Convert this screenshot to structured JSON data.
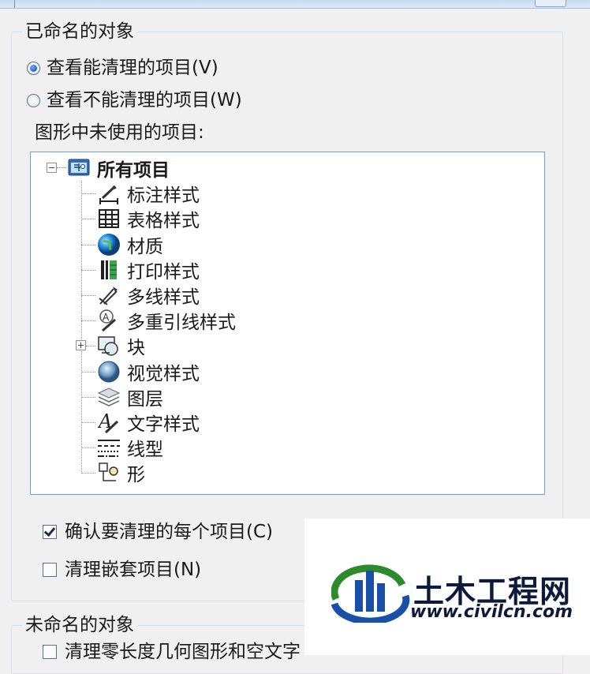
{
  "named_group": {
    "title": "已命名的对象",
    "radio_purgeable": "查看能清理的项目(V)",
    "radio_not_purgeable": "查看不能清理的项目(W)",
    "tree_caption": "图形中未使用的项目:",
    "tree": {
      "root": "所有项目",
      "items": [
        {
          "label": "标注样式",
          "icon": "dimension-style-icon"
        },
        {
          "label": "表格样式",
          "icon": "table-style-icon"
        },
        {
          "label": "材质",
          "icon": "material-globe-icon"
        },
        {
          "label": "打印样式",
          "icon": "plot-style-icon"
        },
        {
          "label": "多线样式",
          "icon": "multiline-style-icon"
        },
        {
          "label": "多重引线样式",
          "icon": "multileader-style-icon"
        },
        {
          "label": "块",
          "icon": "block-icon"
        },
        {
          "label": "视觉样式",
          "icon": "visual-style-icon"
        },
        {
          "label": "图层",
          "icon": "layers-icon"
        },
        {
          "label": "文字样式",
          "icon": "text-style-icon"
        },
        {
          "label": "线型",
          "icon": "linetype-icon"
        },
        {
          "label": "形",
          "icon": "shape-icon"
        }
      ]
    },
    "check_confirm": "确认要清理的每个项目(C)",
    "check_nested": "清理嵌套项目(N)"
  },
  "unnamed_group": {
    "title": "未命名的对象",
    "check_partial": "清理零长度几何图形和空文字"
  },
  "watermark": {
    "title": "土木工程网",
    "url": "www.civilcn.com"
  },
  "state": {
    "radio_purgeable_selected": true,
    "confirm_checked": true,
    "nested_checked": false
  }
}
